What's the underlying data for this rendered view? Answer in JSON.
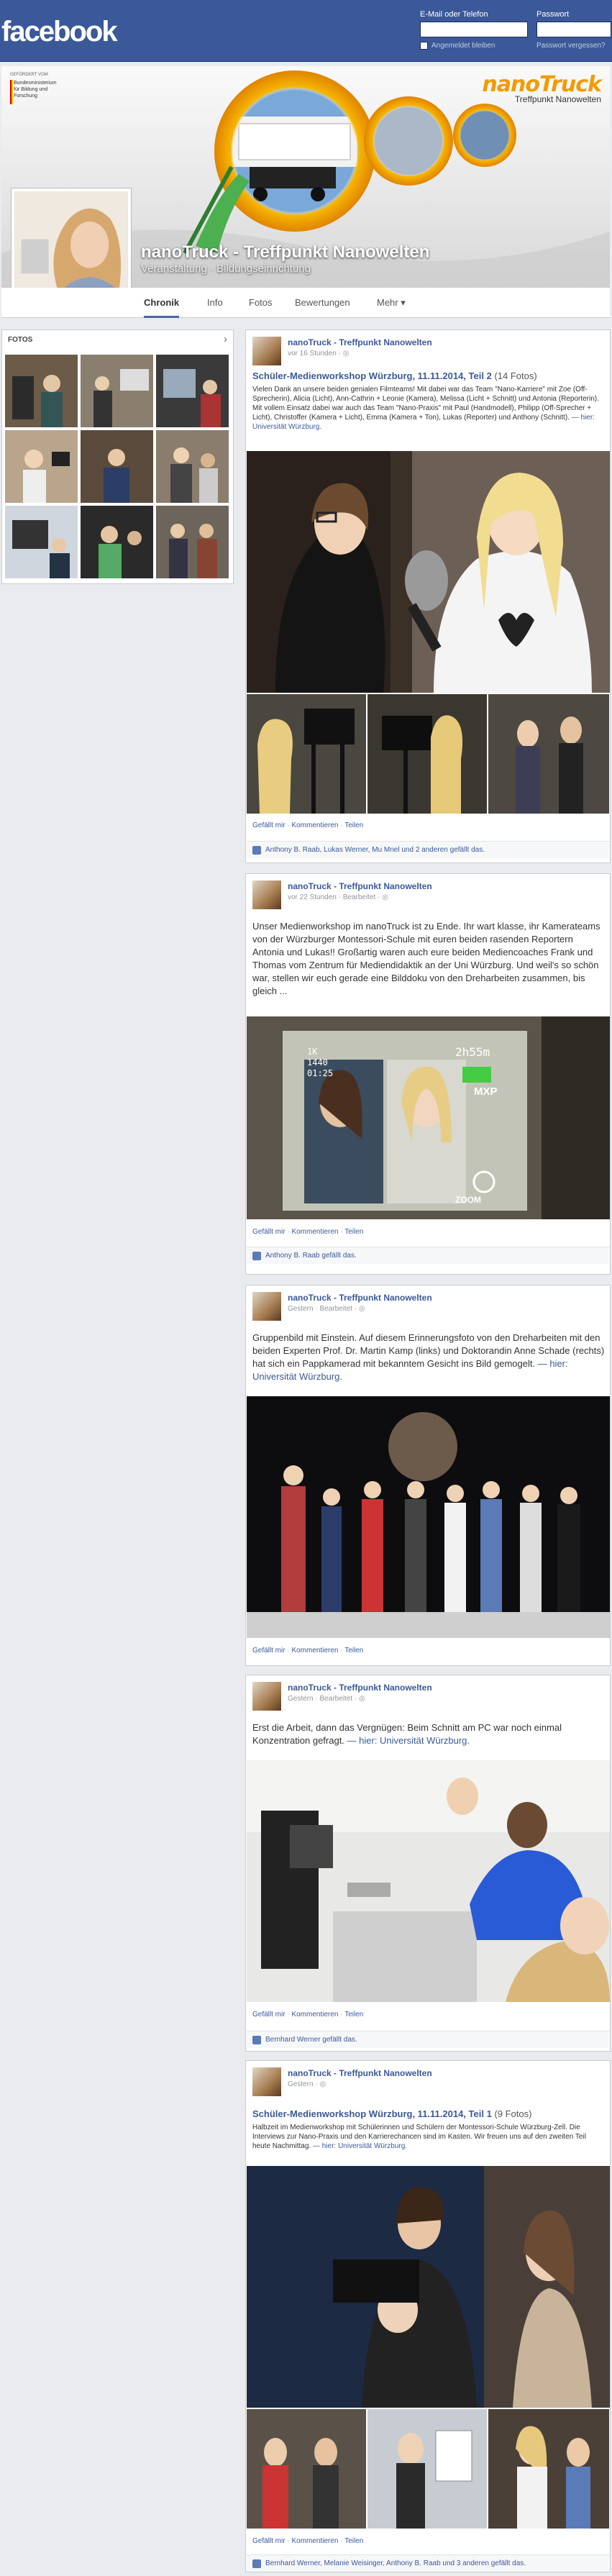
{
  "header": {
    "logo": "facebook",
    "email_label": "E-Mail oder Telefon",
    "password_label": "Passwort",
    "remember_label": "Angemeldet bleiben",
    "forgot_label": "Passwort vergessen?"
  },
  "cover": {
    "gov_text": "Bundesministerium für Bildung und Forschung",
    "gov_caption": "GEFÖRDERT VOM",
    "logo_main": "nanoTruck",
    "logo_sub": "Treffpunkt Nanowelten",
    "page_name": "nanoTruck - Treffpunkt Nanowelten",
    "category": "Veranstaltung · Bildungseinrichtung"
  },
  "nav": {
    "tabs": [
      {
        "label": "Chronik"
      },
      {
        "label": "Info"
      },
      {
        "label": "Fotos"
      },
      {
        "label": "Bewertungen"
      },
      {
        "label": "Mehr ▾"
      }
    ]
  },
  "sidebar": {
    "fotos_title": "FOTOS",
    "chevron": "›"
  },
  "posts": [
    {
      "author": "nanoTruck - Treffpunkt Nanowelten",
      "time": "vor 16 Stunden · ",
      "title": "Schüler-Medienworkshop Würzburg, 11.11.2014, Teil 2",
      "count": "(14 Fotos)",
      "text": "Vielen Dank an unsere beiden genialen Filmteams! Mit dabei war das Team \"Nano-Karriere\" mit Zoe (Off-Sprecherin), Alicia (Licht), Ann-Cathrin + Leonie (Kamera), Melissa (Licht + Schnitt) und Antonia (Reporterin). Mit vollem Einsatz dabei war auch das Team \"Nano-Praxis\" mit Paul (Handmodell), Philipp (Off-Sprecher + Licht), Christoffer (Kamera + Licht), Emma (Kamera + Ton), Lukas (Reporter) und Anthony (Schnitt).",
      "place": " — hier: Universität Würzburg.",
      "actions": [
        "Gefällt mir",
        "Kommentieren",
        "Teilen"
      ],
      "likes": "Anthony B. Raab, Lukas Werner, Mu Mnel und 2 anderen gefällt das."
    },
    {
      "author": "nanoTruck - Treffpunkt Nanowelten",
      "time": "vor 22 Stunden · Bearbeitet · ",
      "text": "Unser Medienworkshop im nanoTruck ist zu Ende. Ihr wart klasse, ihr Kamerateams von der Würzburger Montessori-Schule mit euren beiden rasenden Reportern Antonia und Lukas!! Großartig waren auch eure beiden Mediencoaches Frank und Thomas vom Zentrum für Mediendidaktik an der Uni Würzburg. Und weil's so schön war, stellen wir euch gerade eine Bilddoku von den Dreharbeiten zusammen, bis gleich ...",
      "actions": [
        "Gefällt mir",
        "Kommentieren",
        "Teilen"
      ],
      "likes": "Anthony B. Raab gefällt das.",
      "screen": {
        "lines": [
          "1K",
          "1440",
          "01:25"
        ],
        "timer": "2h55m",
        "label": "MXP",
        "zoom": "ZOOM"
      }
    },
    {
      "author": "nanoTruck - Treffpunkt Nanowelten",
      "time": "Gestern · Bearbeitet · ",
      "text": "Gruppenbild mit Einstein. Auf diesem Erinnerungsfoto von den Dreharbeiten mit den beiden Experten Prof. Dr. Martin Kamp (links) und Doktorandin Anne Schade (rechts) hat sich ein Pappkamerad mit bekanntem Gesicht ins Bild gemogelt.",
      "place": " — hier: Universität Würzburg.",
      "actions": [
        "Gefällt mir",
        "Kommentieren",
        "Teilen"
      ]
    },
    {
      "author": "nanoTruck - Treffpunkt Nanowelten",
      "time": "Gestern · Bearbeitet · ",
      "text": "Erst die Arbeit, dann das Vergnügen: Beim Schnitt am PC war noch einmal Konzentration gefragt.",
      "place": " — hier: Universität Würzburg.",
      "actions": [
        "Gefällt mir",
        "Kommentieren",
        "Teilen"
      ],
      "likes": "Bernhard Werner gefällt das."
    },
    {
      "author": "nanoTruck - Treffpunkt Nanowelten",
      "time": "Gestern · ",
      "title": "Schüler-Medienworkshop Würzburg, 11.11.2014, Teil 1",
      "count": "(9 Fotos)",
      "text": "Halbzeit im Medienworkshop mit Schülerinnen und Schülern der Montessori-Schule Würzburg-Zell. Die Interviews zur Nano-Praxis und den Karrierechancen sind im Kasten. Wir freuen uns auf den zweiten Teil heute Nachmittag.",
      "place": " — hier: Universität Würzburg.",
      "actions": [
        "Gefällt mir",
        "Kommentieren",
        "Teilen"
      ],
      "likes": "Bernhard Werner, Melanie Weisinger, Anthony B. Raab und 3 anderen gefällt das."
    }
  ],
  "colors": {
    "brand": "#3b5998",
    "orange": "#f29b00",
    "bg": "#e9ebee"
  }
}
